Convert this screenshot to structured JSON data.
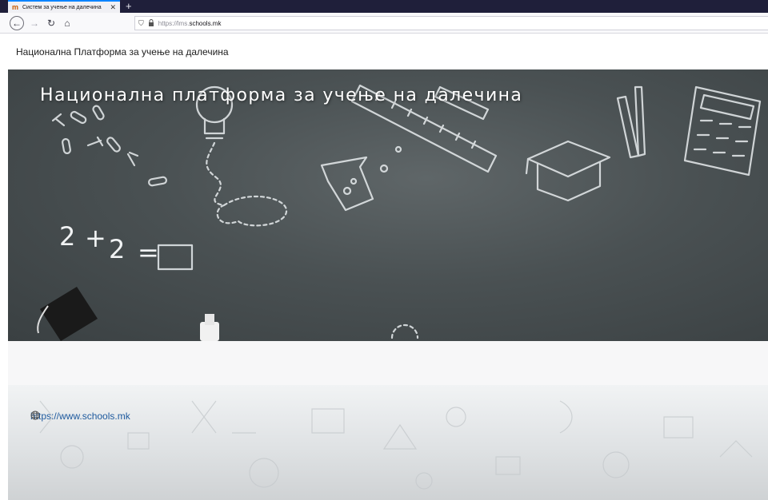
{
  "browser": {
    "tab_title": "Систем за учење на далечина",
    "new_tab_symbol": "+",
    "close_symbol": "✕",
    "url_prefix": "https://lms.",
    "url_domain": "schools.mk"
  },
  "header": {
    "site_name": "Национална Платформа за учење на далечина"
  },
  "hero": {
    "title": "Национална платформа за учење на далечина",
    "equation": {
      "left": "2",
      "plus": "+",
      "right": "2",
      "equals": "="
    }
  },
  "footer": {
    "link_text": "https://www.schools.mk"
  },
  "icons": {
    "favicon": "moodle-icon",
    "back": "back-arrow-icon",
    "forward": "forward-arrow-icon",
    "reload": "reload-icon",
    "home": "home-icon",
    "shield": "shield-icon",
    "lock": "lock-icon",
    "globe": "globe-icon"
  },
  "colors": {
    "tabbar": "#1f1f3a",
    "chalkboard": "#4a5153",
    "link": "#1e5a9e"
  }
}
